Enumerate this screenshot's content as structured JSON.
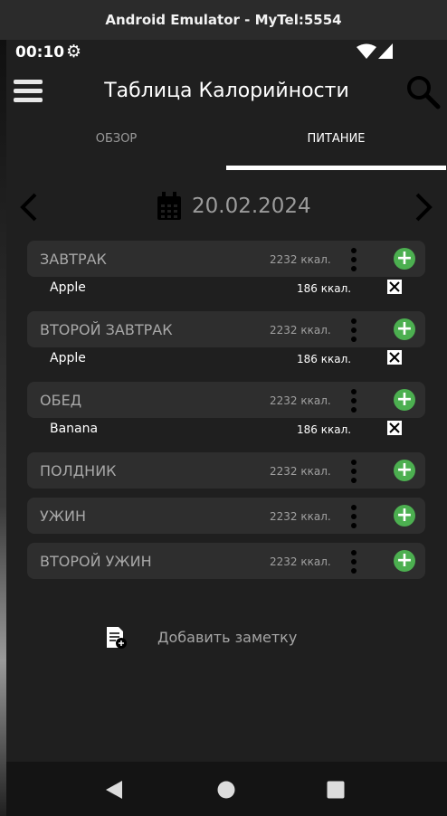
{
  "window_title": "Android Emulator - MyTel:5554",
  "status": {
    "time": "00:10"
  },
  "app": {
    "title": "Таблица Калорийности"
  },
  "tabs": [
    {
      "label": "ОБЗОР",
      "active": false
    },
    {
      "label": "ПИТАНИЕ",
      "active": true
    }
  ],
  "date": "20.02.2024",
  "meals": [
    {
      "name": "ЗАВТРАК",
      "kcal": "2232 ккал.",
      "items": [
        {
          "name": "Apple",
          "kcal": "186 ккал."
        }
      ]
    },
    {
      "name": "ВТОРОЙ ЗАВТРАК",
      "kcal": "2232 ккал.",
      "items": [
        {
          "name": "Apple",
          "kcal": "186 ккал."
        }
      ]
    },
    {
      "name": "ОБЕД",
      "kcal": "2232 ккал.",
      "items": [
        {
          "name": "Banana",
          "kcal": "186 ккал."
        }
      ]
    },
    {
      "name": "ПОЛДНИК",
      "kcal": "2232 ккал.",
      "items": []
    },
    {
      "name": "УЖИН",
      "kcal": "2232 ккал.",
      "items": []
    },
    {
      "name": "ВТОРОЙ УЖИН",
      "kcal": "2232 ккал.",
      "items": []
    }
  ],
  "note": {
    "label": "Добавить заметку"
  },
  "icons": {
    "menu": "hamburger-icon",
    "search": "search-icon",
    "calendar": "calendar-icon",
    "add": "plus-circle-icon",
    "more": "more-vert-icon",
    "delete": "checkbox-x-icon",
    "note": "note-add-icon",
    "back": "triangle-back-icon",
    "home": "circle-home-icon",
    "recents": "square-recents-icon"
  },
  "colors": {
    "accent_green": "#4caf50",
    "background": "#1f1f1f",
    "card": "#2e2e2e"
  }
}
